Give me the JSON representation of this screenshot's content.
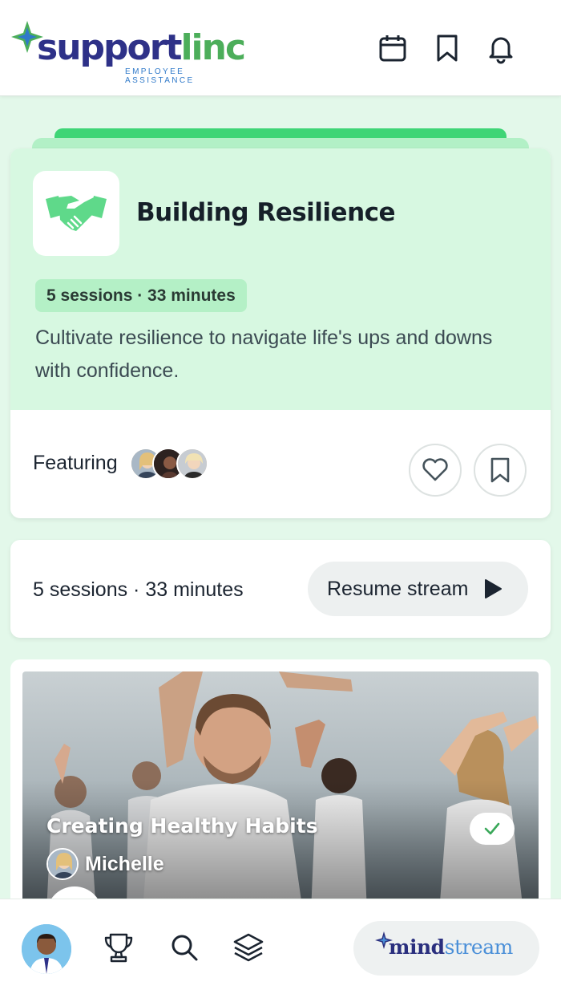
{
  "header": {
    "logo_main": "support",
    "logo_accent": "linc",
    "logo_sub": "EMPLOYEE ASSISTANCE",
    "icons": [
      "calendar-icon",
      "bookmark-icon",
      "bell-icon"
    ]
  },
  "program": {
    "title": "Building Resilience",
    "icon": "handshake-icon",
    "sessions_badge": "5 sessions · 33 minutes",
    "description": "Cultivate resilience to navigate life's ups and downs with confidence.",
    "featuring_label": "Featuring",
    "featuring_avatars": 3
  },
  "sessions_bar": {
    "summary": "5 sessions · 33 minutes",
    "resume_label": "Resume stream"
  },
  "session_card": {
    "title": "Creating Healthy Habits",
    "host": "Michelle",
    "completed": true
  },
  "bottom_nav": {
    "items": [
      "profile-avatar",
      "trophy-icon",
      "search-icon",
      "layers-icon"
    ],
    "brand_main": "mind",
    "brand_accent": "stream"
  },
  "colors": {
    "accent_green": "#3fd576",
    "light_green": "#d7f8e1",
    "page_bg": "#e3f8ea",
    "brand_navy": "#2e3188",
    "brand_green": "#4cae5a"
  }
}
